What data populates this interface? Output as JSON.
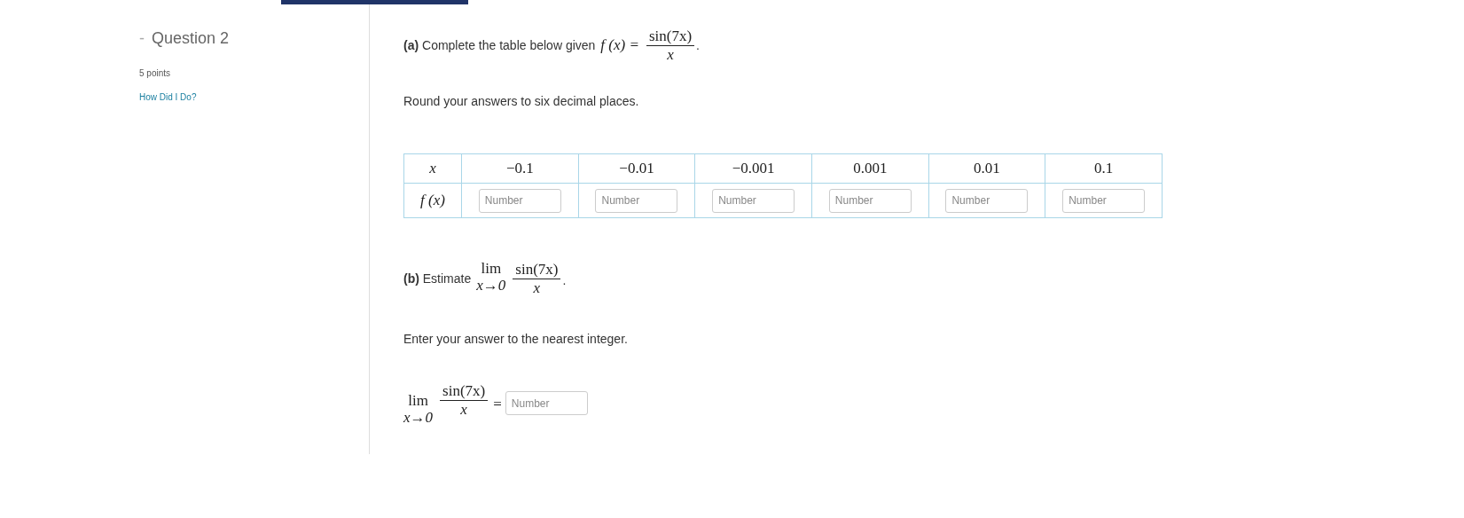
{
  "sidebar": {
    "toggle": "-",
    "title": "Question 2",
    "points": "5 points",
    "link": "How Did I Do?"
  },
  "part_a": {
    "label": "(a)",
    "text": "Complete the table below given",
    "formula": {
      "lhs": "f (x) =",
      "numerator": "sin(7x)",
      "denominator": "x",
      "end": "."
    },
    "instruction": "Round your answers to six decimal places."
  },
  "table": {
    "x_label": "x",
    "x_values": [
      "−0.1",
      "−0.01",
      "−0.001",
      "0.001",
      "0.01",
      "0.1"
    ],
    "f_label": "f (x)",
    "inputs": [
      {
        "placeholder": "Number"
      },
      {
        "placeholder": "Number"
      },
      {
        "placeholder": "Number"
      },
      {
        "placeholder": "Number"
      },
      {
        "placeholder": "Number"
      },
      {
        "placeholder": "Number"
      }
    ]
  },
  "part_b": {
    "label": "(b)",
    "text": "Estimate",
    "formula": {
      "lim": "lim",
      "under": "x→0",
      "numerator": "sin(7x)",
      "denominator": "x",
      "end": "."
    },
    "instruction": "Enter your answer to the nearest integer.",
    "answer": {
      "lim": "lim",
      "under": "x→0",
      "numerator": "sin(7x)",
      "denominator": "x",
      "equals": "=",
      "placeholder": "Number"
    }
  }
}
